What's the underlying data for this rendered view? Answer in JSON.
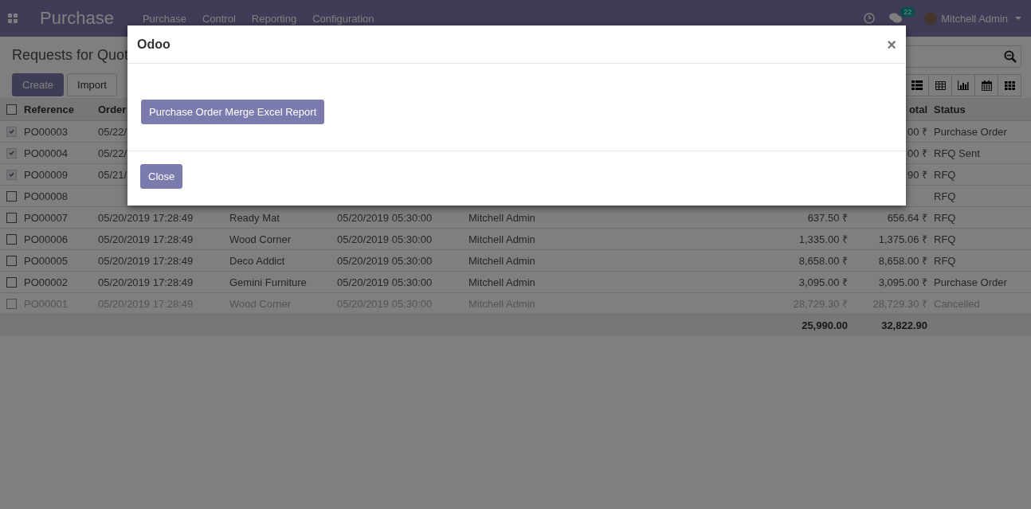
{
  "navbar": {
    "brand": "Purchase",
    "menu": [
      "Purchase",
      "Control",
      "Reporting",
      "Configuration"
    ],
    "messages_count": "22",
    "user": "Mitchell Admin"
  },
  "control_panel": {
    "title": "Requests for Quot",
    "buttons": [
      {
        "label": "Create",
        "kind": "primary"
      },
      {
        "label": "Import",
        "kind": "secondary"
      }
    ]
  },
  "table": {
    "header": {
      "reference": "Reference",
      "column_2": "Order",
      "all_selected": false,
      "column_8": "otal",
      "status": "Status"
    },
    "rows": [
      {
        "selected": true,
        "cancelled": false,
        "reference": "PO00003",
        "order_date": "05/22/",
        "total": "00 ₹",
        "status": "Purchase Order"
      },
      {
        "selected": true,
        "cancelled": false,
        "reference": "PO00004",
        "order_date": "05/22/",
        "total": "00 ₹",
        "status": "RFQ Sent"
      },
      {
        "selected": true,
        "cancelled": false,
        "reference": "PO00009",
        "order_date": "05/21/",
        "total": "90 ₹",
        "status": "RFQ"
      },
      {
        "selected": false,
        "cancelled": false,
        "reference": "PO00008",
        "status": "RFQ"
      },
      {
        "selected": false,
        "cancelled": false,
        "reference": "PO00007",
        "order_date": "05/20/2019 17:28:49",
        "vendor": "Ready Mat",
        "scheduled_date": "05/20/2019 05:30:00",
        "representative": "Mitchell Admin",
        "untaxed": "637.50 ₹",
        "total": "656.64 ₹",
        "status": "RFQ"
      },
      {
        "selected": false,
        "cancelled": false,
        "reference": "PO00006",
        "order_date": "05/20/2019 17:28:49",
        "vendor": "Wood Corner",
        "scheduled_date": "05/20/2019 05:30:00",
        "representative": "Mitchell Admin",
        "untaxed": "1,335.00 ₹",
        "total": "1,375.06 ₹",
        "status": "RFQ"
      },
      {
        "selected": false,
        "cancelled": false,
        "reference": "PO00005",
        "order_date": "05/20/2019 17:28:49",
        "vendor": "Deco Addict",
        "scheduled_date": "05/20/2019 05:30:00",
        "representative": "Mitchell Admin",
        "untaxed": "8,658.00 ₹",
        "total": "8,658.00 ₹",
        "status": "RFQ"
      },
      {
        "selected": false,
        "cancelled": false,
        "reference": "PO00002",
        "order_date": "05/20/2019 17:28:49",
        "vendor": "Gemini Furniture",
        "scheduled_date": "05/20/2019 05:30:00",
        "representative": "Mitchell Admin",
        "untaxed": "3,095.00 ₹",
        "total": "3,095.00 ₹",
        "status": "Purchase Order"
      },
      {
        "selected": false,
        "cancelled": true,
        "reference": "PO00001",
        "order_date": "05/20/2019 17:28:49",
        "vendor": "Wood Corner",
        "scheduled_date": "05/20/2019 05:30:00",
        "representative": "Mitchell Admin",
        "untaxed": "28,729.30 ₹",
        "total": "28,729.30 ₹",
        "status": "Cancelled"
      }
    ],
    "footer": {
      "untaxed": "25,990.00",
      "total": "32,822.90"
    }
  },
  "dialog": {
    "title": "Odoo",
    "close_icon": "×",
    "report_button": "Purchase Order Merge Excel Report",
    "footer_button": "Close"
  }
}
